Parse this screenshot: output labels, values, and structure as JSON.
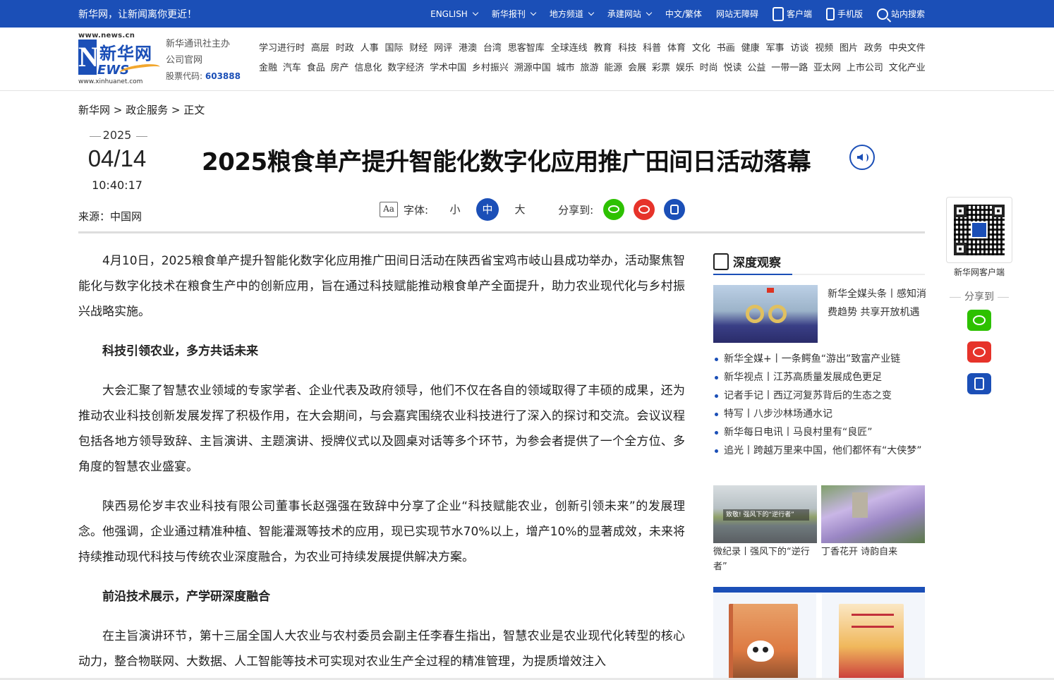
{
  "topbar": {
    "slogan": "新华网，让新闻离你更近！",
    "nav": [
      {
        "label": "ENGLISH",
        "dropdown": true
      },
      {
        "label": "新华报刊",
        "dropdown": true
      },
      {
        "label": "地方频道",
        "dropdown": true
      },
      {
        "label": "承建网站",
        "dropdown": true
      },
      {
        "label": "中文/繁体",
        "dropdown": false
      },
      {
        "label": "网站无障碍",
        "dropdown": false
      }
    ],
    "client_label": "客户端",
    "mobile_label": "手机版",
    "search_label": "站内搜索"
  },
  "logo": {
    "url_top": "www.news.cn",
    "n": "N",
    "cn": "新华网",
    "ews": "EWS",
    "url_bottom": "www.xinhuanet.com"
  },
  "org": {
    "line1": "新华通讯社主办",
    "line2": "公司官网",
    "stock_label": "股票代码:",
    "stock_code": "603888"
  },
  "channels": {
    "row1": [
      "学习进行时",
      "高层",
      "时政",
      "人事",
      "国际",
      "财经",
      "网评",
      "港澳",
      "台湾",
      "思客智库",
      "全球连线",
      "教育",
      "科技",
      "科普",
      "体育",
      "文化",
      "书画",
      "健康",
      "军事",
      "访谈",
      "视频",
      "图片",
      "政务",
      "中央文件"
    ],
    "row2": [
      "金融",
      "汽车",
      "食品",
      "房产",
      "信息化",
      "数字经济",
      "学术中国",
      "乡村振兴",
      "溯源中国",
      "城市",
      "旅游",
      "能源",
      "会展",
      "彩票",
      "娱乐",
      "时尚",
      "悦读",
      "公益",
      "一带一路",
      "亚太网",
      "上市公司",
      "文化产业"
    ]
  },
  "breadcrumb": "新华网 > 政企服务 > 正文",
  "date": {
    "year": "2025",
    "month_day": "04/14",
    "time": "10:40:17"
  },
  "source": "来源：中国网",
  "title": "2025粮食单产提升智能化数字化应用推广田间日活动落幕",
  "tools": {
    "font_label": "字体:",
    "font_sizes": [
      "小",
      "中",
      "大"
    ],
    "active_size": "中",
    "share_label": "分享到:"
  },
  "article": [
    {
      "type": "p",
      "text": "4月10日，2025粮食单产提升智能化数字化应用推广田间日活动在陕西省宝鸡市岐山县成功举办，活动聚焦智能化与数字化技术在粮食生产中的创新应用，旨在通过科技赋能推动粮食单产全面提升，助力农业现代化与乡村振兴战略实施。"
    },
    {
      "type": "sub",
      "text": "科技引领农业，多方共话未来"
    },
    {
      "type": "p",
      "text": "大会汇聚了智慧农业领域的专家学者、企业代表及政府领导，他们不仅在各自的领域取得了丰硕的成果，还为推动农业科技创新发展发挥了积极作用，在大会期间，与会嘉宾围绕农业科技进行了深入的探讨和交流。会议议程包括各地方领导致辞、主旨演讲、主题演讲、授牌仪式以及圆桌对话等多个环节，为参会者提供了一个全方位、多角度的智慧农业盛宴。"
    },
    {
      "type": "p",
      "text": "陕西易伦岁丰农业科技有限公司董事长赵强强在致辞中分享了企业“科技赋能农业，创新引领未来”的发展理念。他强调，企业通过精准种植、智能灌溉等技术的应用，现已实现节水70%以上，增产10%的显著成效，未来将持续推动现代科技与传统农业深度融合，为农业可持续发展提供解决方案。"
    },
    {
      "type": "sub",
      "text": "前沿技术展示，产学研深度融合"
    },
    {
      "type": "p",
      "text": "在主旨演讲环节，第十三届全国人大农业与农村委员会副主任李春生指出，智慧农业是农业现代化转型的核心动力，整合物联网、大数据、人工智能等技术可实现对农业生产全过程的精准管理，为提质增效注入"
    }
  ],
  "sidebar": {
    "heading": "深度观察",
    "feature": {
      "text": "新华全媒头条丨感知消费趋势 共享开放机遇"
    },
    "list": [
      "新华全媒+丨一条鳄鱼“游出”致富产业链",
      "新华视点丨江苏高质量发展成色更足",
      "记者手记丨西辽河复苏背后的生态之变",
      "特写丨八步沙林场通水记",
      "新华每日电讯丨马良村里有“良匠”",
      "追光丨跨越万里来中国，他们都怀有“大侠梦”"
    ],
    "pics": [
      {
        "title": "微纪录丨强风下的“逆行者”",
        "overlay": "致敬! 强风下的“逆行者”"
      },
      {
        "title": "丁香花开 诗韵自来"
      }
    ]
  },
  "floating": {
    "qr_label": "新华网客户端",
    "share_label": "分享到"
  },
  "colors": {
    "brand_blue": "#1b4fb7",
    "wechat_green": "#2dc100",
    "weibo_red": "#e6332a"
  }
}
